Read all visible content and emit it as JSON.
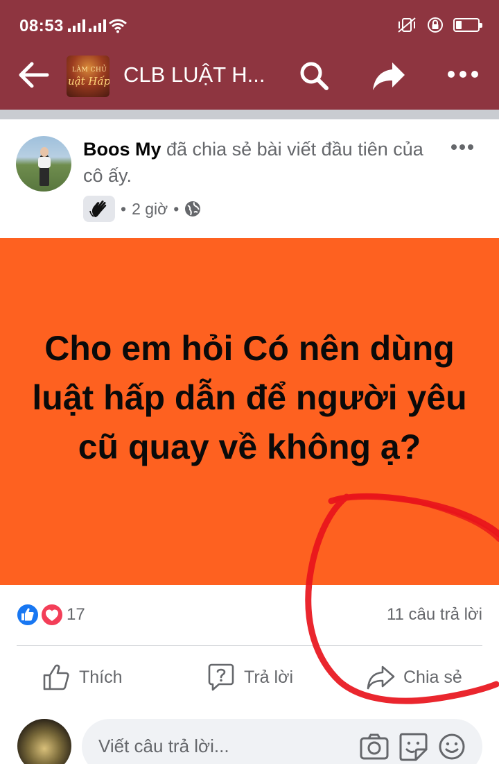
{
  "status_bar": {
    "time": "08:53",
    "battery_level_percent": 25
  },
  "app_bar": {
    "group_title": "CLB LUẬT H...",
    "group_thumb_line1": "LÀM CHỦ",
    "group_thumb_line2": "uật Hấp D",
    "accent_color": "#8e3540"
  },
  "post": {
    "author": "Boos My",
    "action_text": " đã chia sẻ bài viết đầu tiên của cô ấy.",
    "time_ago": "2 giờ",
    "separator": "•",
    "card_text": "Cho em hỏi Có nên dùng luật hấp dẫn để người yêu cũ quay về không ạ?",
    "card_color": "#fe6120",
    "reaction_count": "17",
    "answers_count": "11 câu trả lời",
    "icons": [
      "wave-badge-icon",
      "globe-icon",
      "more-icon"
    ]
  },
  "actions": {
    "like_label": "Thích",
    "reply_label": "Trả lời",
    "share_label": "Chia sẻ"
  },
  "composer": {
    "placeholder": "Viết câu trả lời..."
  }
}
